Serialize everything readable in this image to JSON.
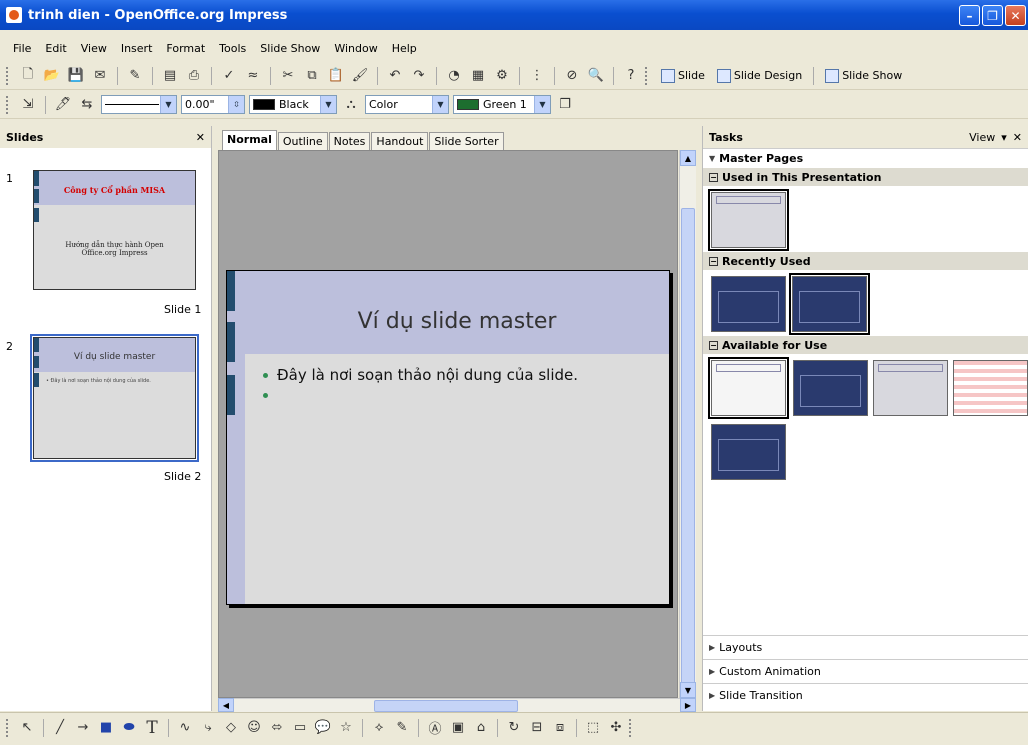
{
  "window": {
    "title": "trinh dien - OpenOffice.org Impress"
  },
  "menu": [
    "File",
    "Edit",
    "View",
    "Insert",
    "Format",
    "Tools",
    "Slide Show",
    "Window",
    "Help"
  ],
  "menu_underline": [
    "F",
    "E",
    "V",
    "I",
    "o",
    "T",
    "S",
    "W",
    "H"
  ],
  "toolbar1": {
    "slide_label": "Slide",
    "slide_design_label": "Slide Design",
    "slide_show_label": "Slide Show"
  },
  "toolbar2": {
    "line_width": "0.00\"",
    "line_color": "Black",
    "area_style": "Color",
    "area_color": "Green 1",
    "colors": {
      "line": "#000000",
      "area": "#1d6e2f"
    }
  },
  "slides_panel": {
    "title": "Slides",
    "slides": [
      {
        "num": "1",
        "title": "Công ty Cổ phần MISA",
        "subtitle": "Hướng dẫn thực hành Open Office.org Impress",
        "label": "Slide 1"
      },
      {
        "num": "2",
        "title": "Ví dụ slide master",
        "body": "• Đây là nơi soạn thảo nội dung của slide.",
        "label": "Slide 2"
      }
    ]
  },
  "view_tabs": [
    "Normal",
    "Outline",
    "Notes",
    "Handout",
    "Slide Sorter"
  ],
  "slide": {
    "title": "Ví dụ slide master",
    "bullets": [
      "Đây là nơi soạn thảo nội dung của slide.",
      ""
    ]
  },
  "tasks": {
    "title": "Tasks",
    "view_label": "View",
    "master_pages": "Master Pages",
    "used": "Used in This Presentation",
    "recent": "Recently Used",
    "available": "Available for Use",
    "layouts": "Layouts",
    "custom_animation": "Custom Animation",
    "slide_transition": "Slide Transition"
  }
}
